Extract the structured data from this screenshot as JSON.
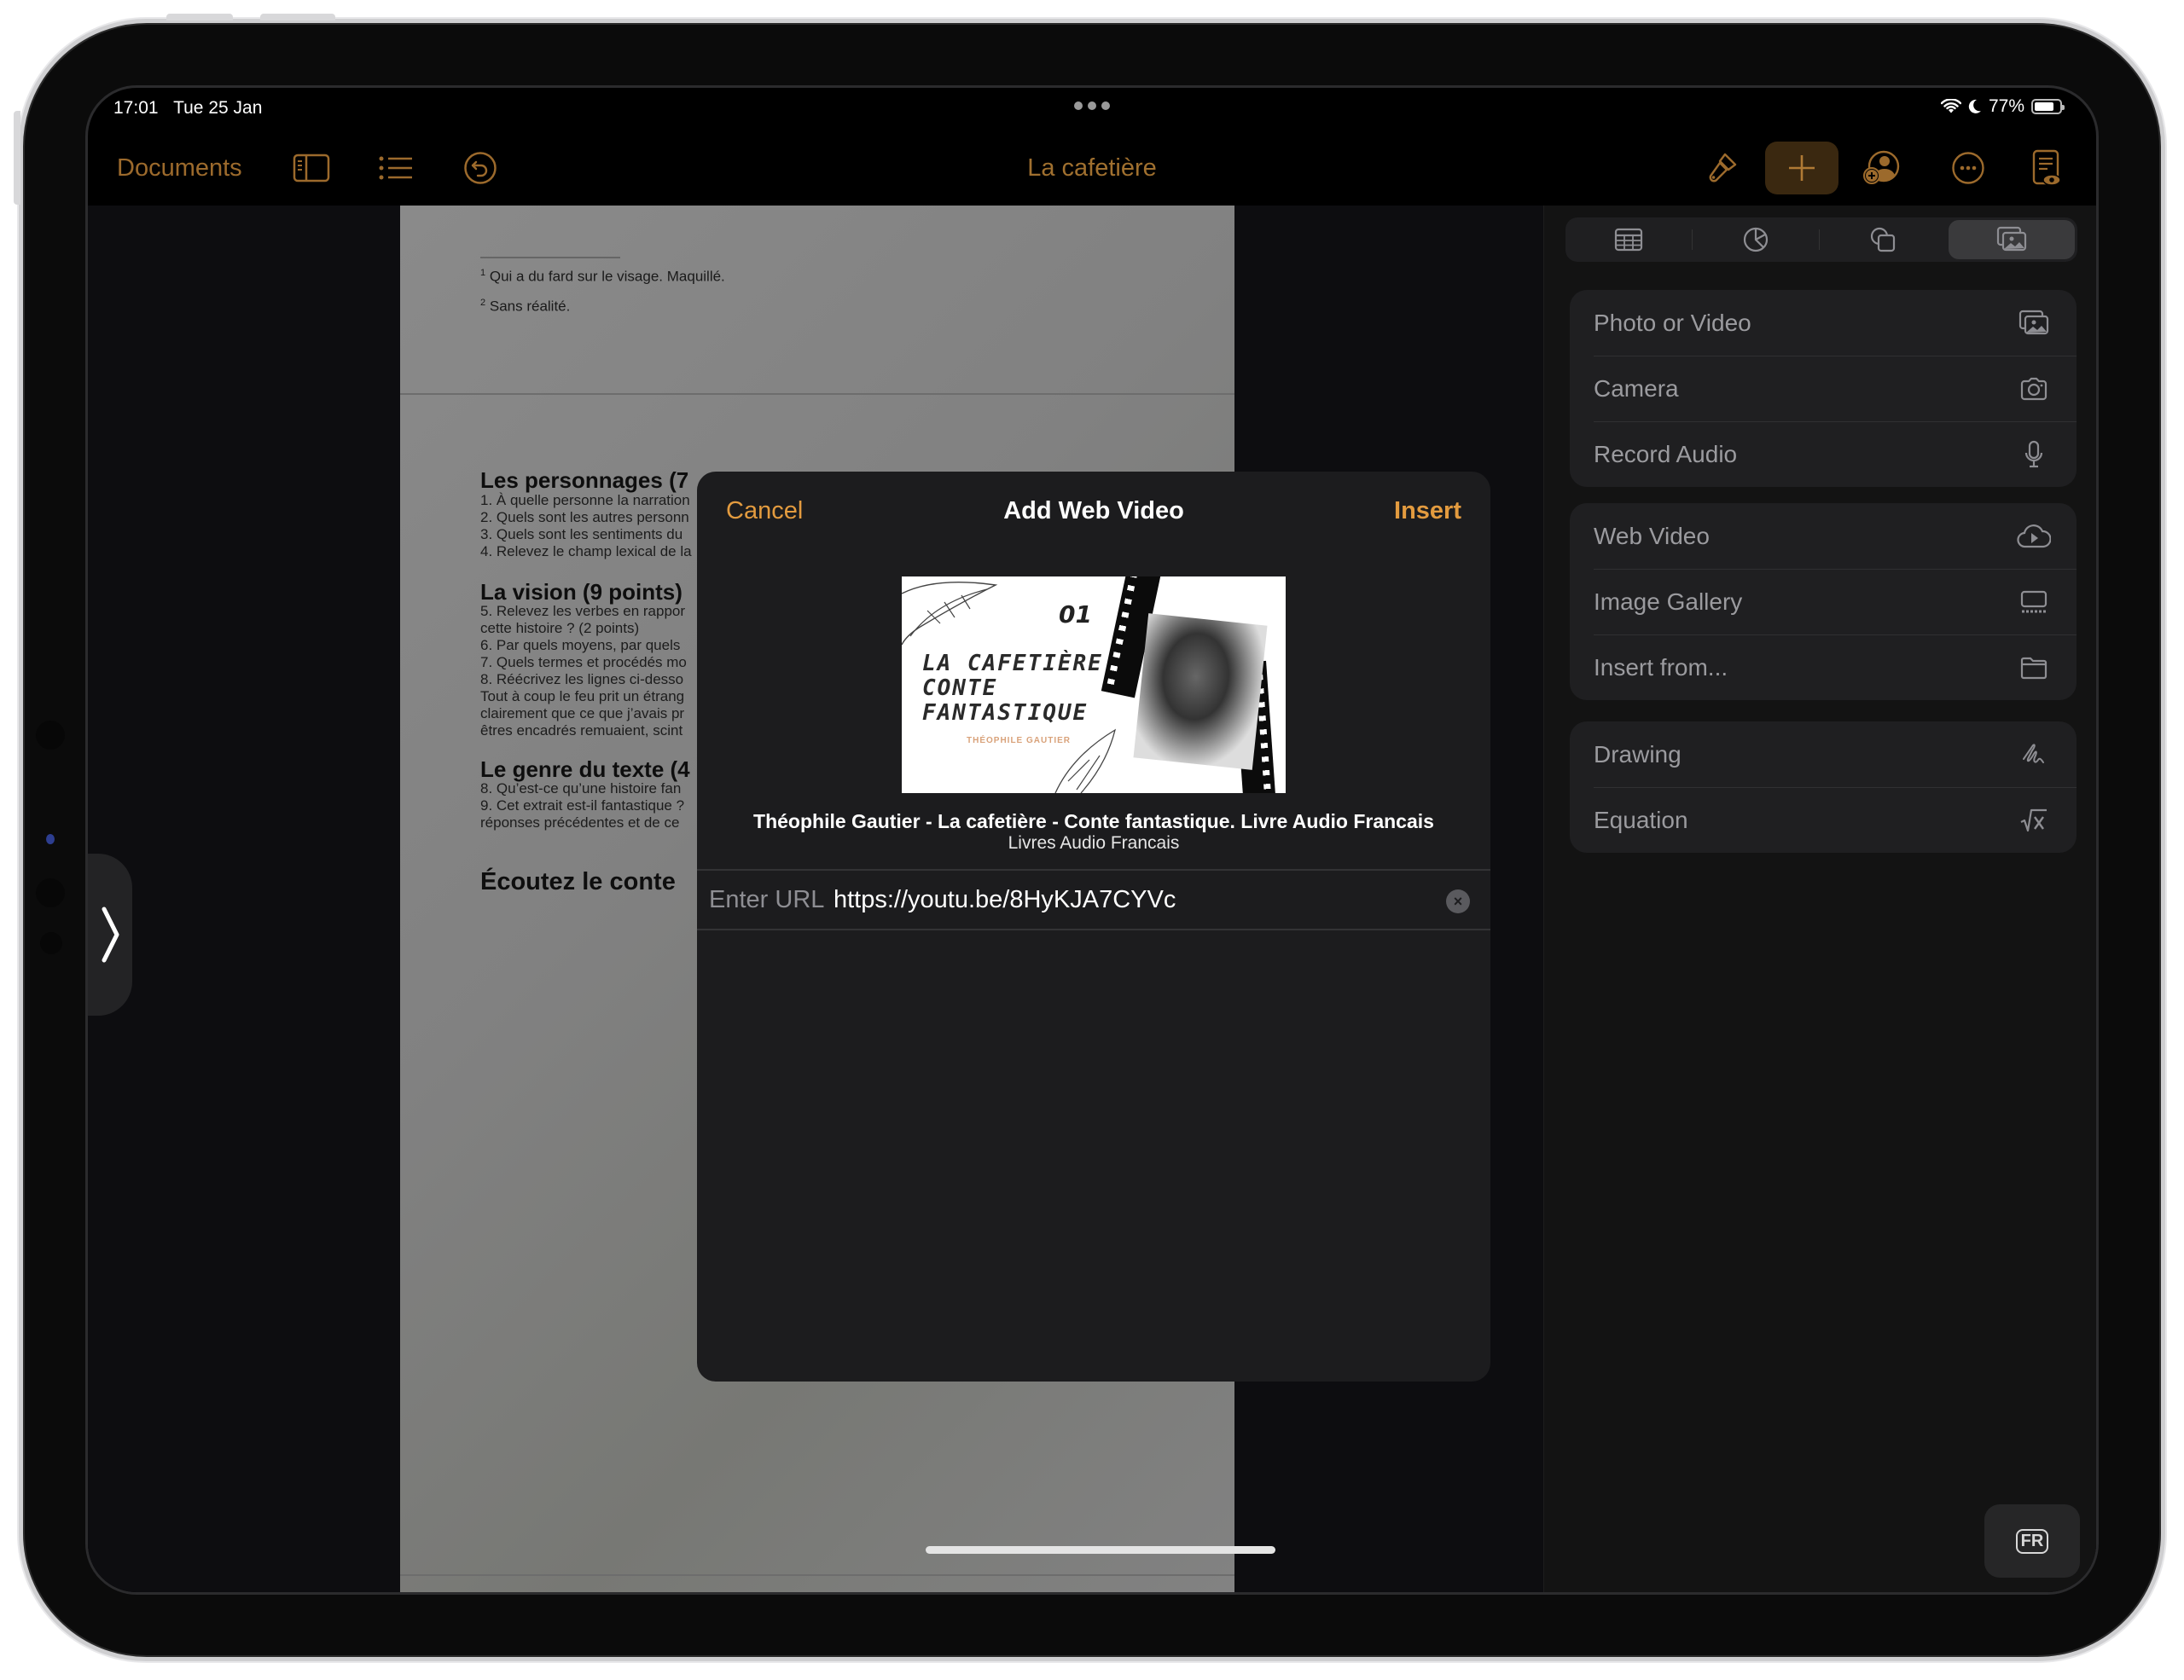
{
  "status_bar": {
    "time": "17:01",
    "date": "Tue 25 Jan",
    "battery_percent_label": "77%",
    "battery_level": 0.77,
    "icons": [
      "wifi-icon",
      "moon-icon",
      "battery-icon"
    ]
  },
  "toolbar": {
    "documents_label": "Documents",
    "title": "La cafetière",
    "left_icons": [
      "sidebar-icon",
      "list-icon",
      "undo-icon"
    ],
    "right_icons": [
      "paintbrush-icon",
      "plus-icon",
      "collaborate-icon",
      "more-icon",
      "reader-view-icon"
    ],
    "accent_color": "#a0702f"
  },
  "document": {
    "footnotes": [
      {
        "num": "1",
        "text": "Qui a du fard sur le visage. Maquillé."
      },
      {
        "num": "2",
        "text": "Sans réalité."
      }
    ],
    "sections": [
      {
        "heading": "Les personnages (7",
        "lines": [
          "1. À quelle personne la narration",
          "2. Quels sont les autres personn",
          "3. Quels sont les sentiments du",
          "4. Relevez le champ lexical de la"
        ]
      },
      {
        "heading": "La vision (9 points)",
        "lines": [
          "5. Relevez les verbes en rappor",
          "cette histoire ? (2 points)",
          "6. Par quels moyens, par quels",
          "7. Quels termes et procédés mo",
          "8. Réécrivez les lignes ci-desso",
          "Tout à coup le feu prit un étrang",
          "clairement que ce que j’avais pr",
          "êtres encadrés remuaient, scint"
        ]
      },
      {
        "heading": "Le genre du texte (4",
        "lines": [
          "8. Qu’est-ce qu’une histoire fan",
          "9. Cet extrait est-il fantastique ?",
          "réponses précédentes et de ce"
        ]
      },
      {
        "heading": "Écoutez le conte",
        "lines": []
      }
    ]
  },
  "insert_panel": {
    "tabs": [
      {
        "icon": "table-icon",
        "active": false
      },
      {
        "icon": "chart-icon",
        "active": false
      },
      {
        "icon": "shapes-icon",
        "active": false
      },
      {
        "icon": "media-icon",
        "active": true
      }
    ],
    "groups": [
      [
        {
          "label": "Photo or Video",
          "icon": "photo-library-icon"
        },
        {
          "label": "Camera",
          "icon": "camera-icon"
        },
        {
          "label": "Record Audio",
          "icon": "microphone-icon"
        }
      ],
      [
        {
          "label": "Web Video",
          "icon": "cloud-play-icon"
        },
        {
          "label": "Image Gallery",
          "icon": "image-gallery-icon"
        },
        {
          "label": "Insert from...",
          "icon": "folder-icon"
        }
      ],
      [
        {
          "label": "Drawing",
          "icon": "scribble-icon"
        },
        {
          "label": "Equation",
          "icon": "square-root-icon"
        }
      ]
    ],
    "keyboard_language": "FR"
  },
  "dialog": {
    "title": "Add Web Video",
    "cancel_label": "Cancel",
    "insert_label": "Insert",
    "accent_color": "#e39b3f",
    "thumbnail": {
      "number": "01",
      "title_lines": [
        "LA CAFETIÈRE,",
        "CONTE",
        "FANTASTIQUE"
      ],
      "author": "THÉOPHILE GAUTIER"
    },
    "video_title": "Théophile Gautier - La cafetière - Conte fantastique. Livre Audio Francais",
    "channel": "Livres Audio Francais",
    "url_label": "Enter URL",
    "url_value": "https://youtu.be/8HyKJA7CYVc"
  }
}
